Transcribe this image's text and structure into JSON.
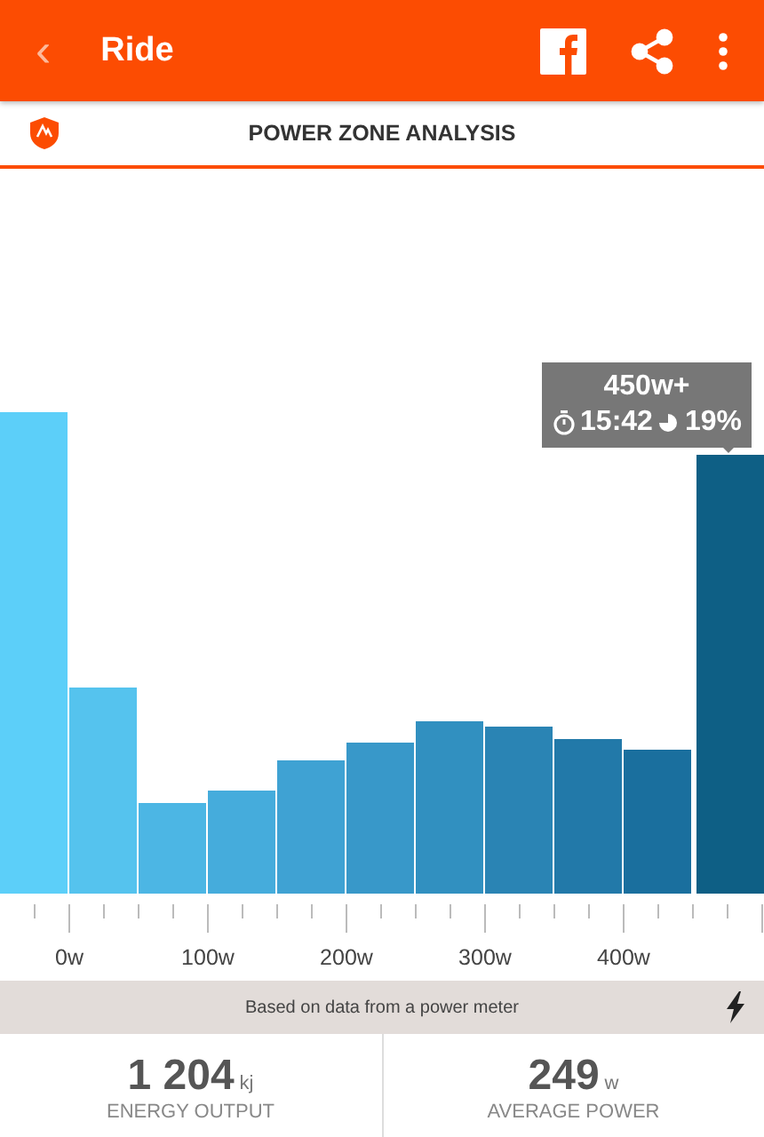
{
  "app_bar": {
    "back": "‹",
    "title": "Ride"
  },
  "section": {
    "title": "POWER ZONE ANALYSIS"
  },
  "histogram": {
    "tooltip": {
      "zone": "450w+",
      "time": "15:42",
      "share": "19%"
    },
    "axis_labels": [
      "0w",
      "100w",
      "200w",
      "300w",
      "400w"
    ]
  },
  "notice": {
    "text": "Based on data from a power meter"
  },
  "stats": [
    {
      "value": "1 204",
      "unit": "kj",
      "label": "ENERGY OUTPUT"
    },
    {
      "value": "249",
      "unit": "w",
      "label": "AVERAGE POWER"
    }
  ]
}
